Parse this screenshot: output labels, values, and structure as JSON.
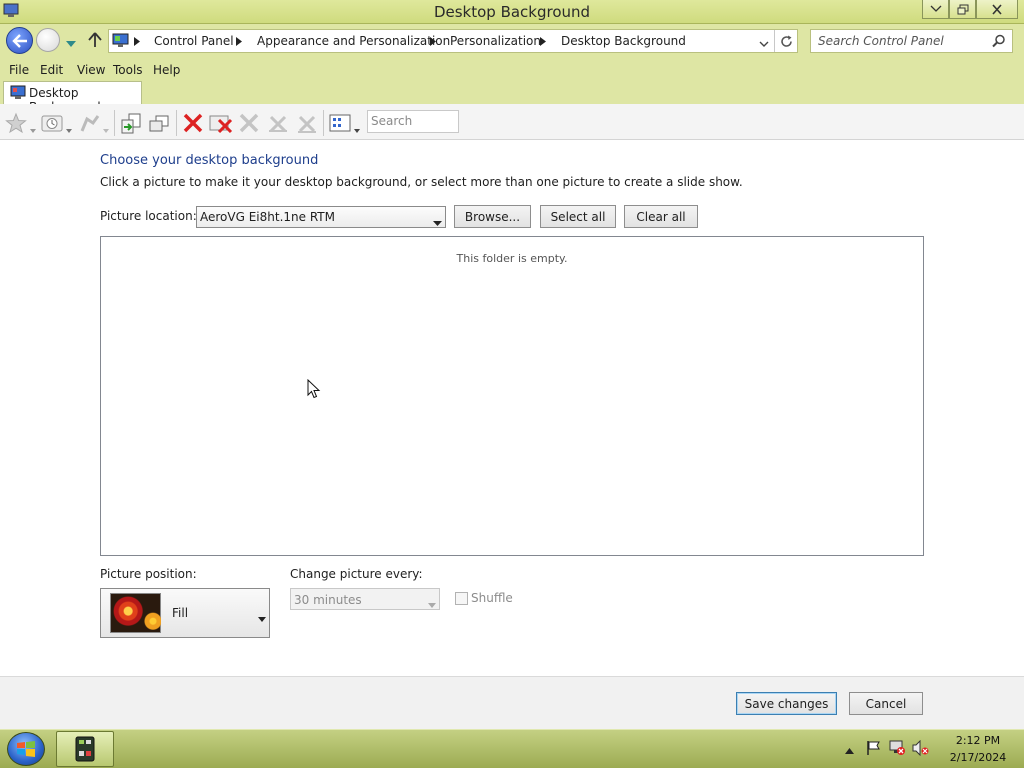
{
  "window": {
    "title": "Desktop Background"
  },
  "address": {
    "crumbs": [
      "Control Panel",
      "Appearance and Personalization",
      "Personalization",
      "Desktop Background"
    ],
    "search_placeholder": "Search Control Panel"
  },
  "menu": [
    "File",
    "Edit",
    "View",
    "Tools",
    "Help"
  ],
  "tab": {
    "label": "Desktop Background"
  },
  "toolbar": {
    "search_placeholder": "Search"
  },
  "page": {
    "heading": "Choose your desktop background",
    "instruction": "Click a picture to make it your desktop background, or select more than one picture to create a slide show.",
    "location_label": "Picture location:",
    "location_value": "AeroVG Ei8ht.1ne RTM",
    "browse_label": "Browse...",
    "select_all_label": "Select all",
    "clear_all_label": "Clear all",
    "empty_message": "This folder is empty.",
    "position_label": "Picture position:",
    "position_value": "Fill",
    "interval_label": "Change picture every:",
    "interval_value": "30 minutes",
    "shuffle_label": "Shuffle"
  },
  "footer": {
    "save_label": "Save changes",
    "cancel_label": "Cancel"
  },
  "taskbar": {
    "time": "2:12 PM",
    "date": "2/17/2024"
  },
  "colors": {
    "heading": "#1e3e8c",
    "chrome": "#dee6a4",
    "taskbar": "#aab85e"
  }
}
